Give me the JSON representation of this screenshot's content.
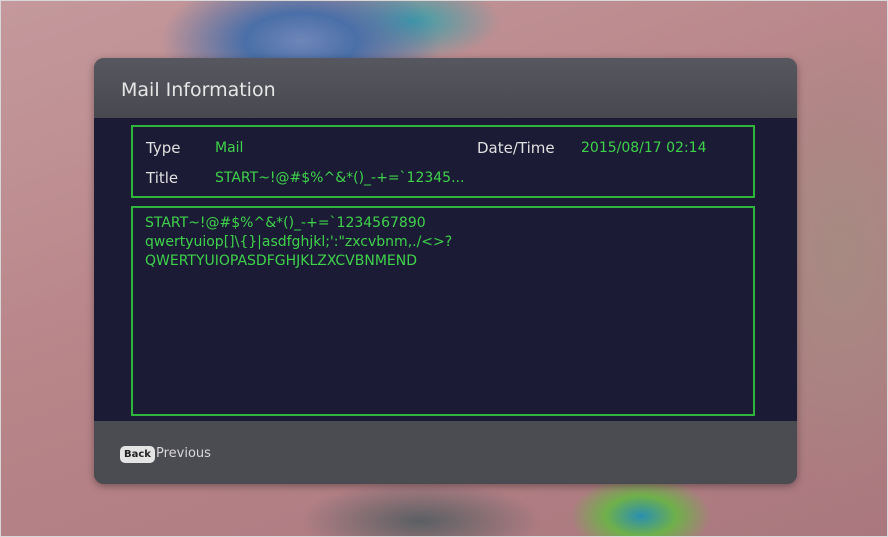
{
  "dialog": {
    "title": "Mail Information"
  },
  "info": {
    "type_label": "Type",
    "type_value": "Mail",
    "datetime_label": "Date/Time",
    "datetime_value": "2015/08/17 02:14",
    "title_label": "Title",
    "title_value": "START~!@#$%^&*()_-+=`12345..."
  },
  "message": {
    "lines": [
      "START~!@#$%^&*()_-+=`1234567890",
      "qwertyuiop[]\\{}|asdfghjkl;':\"zxcvbnm,./<>?",
      "QWERTYUIOPASDFGHJKLZXCVBNMEND"
    ]
  },
  "footer": {
    "back_key_label": "Back",
    "previous_label": "Previous"
  },
  "colors": {
    "accent_green": "#3ed24a",
    "border_green": "#2fb53c",
    "panel_dark": "#1c1b36",
    "dialog_gray": "#4d4d55"
  }
}
